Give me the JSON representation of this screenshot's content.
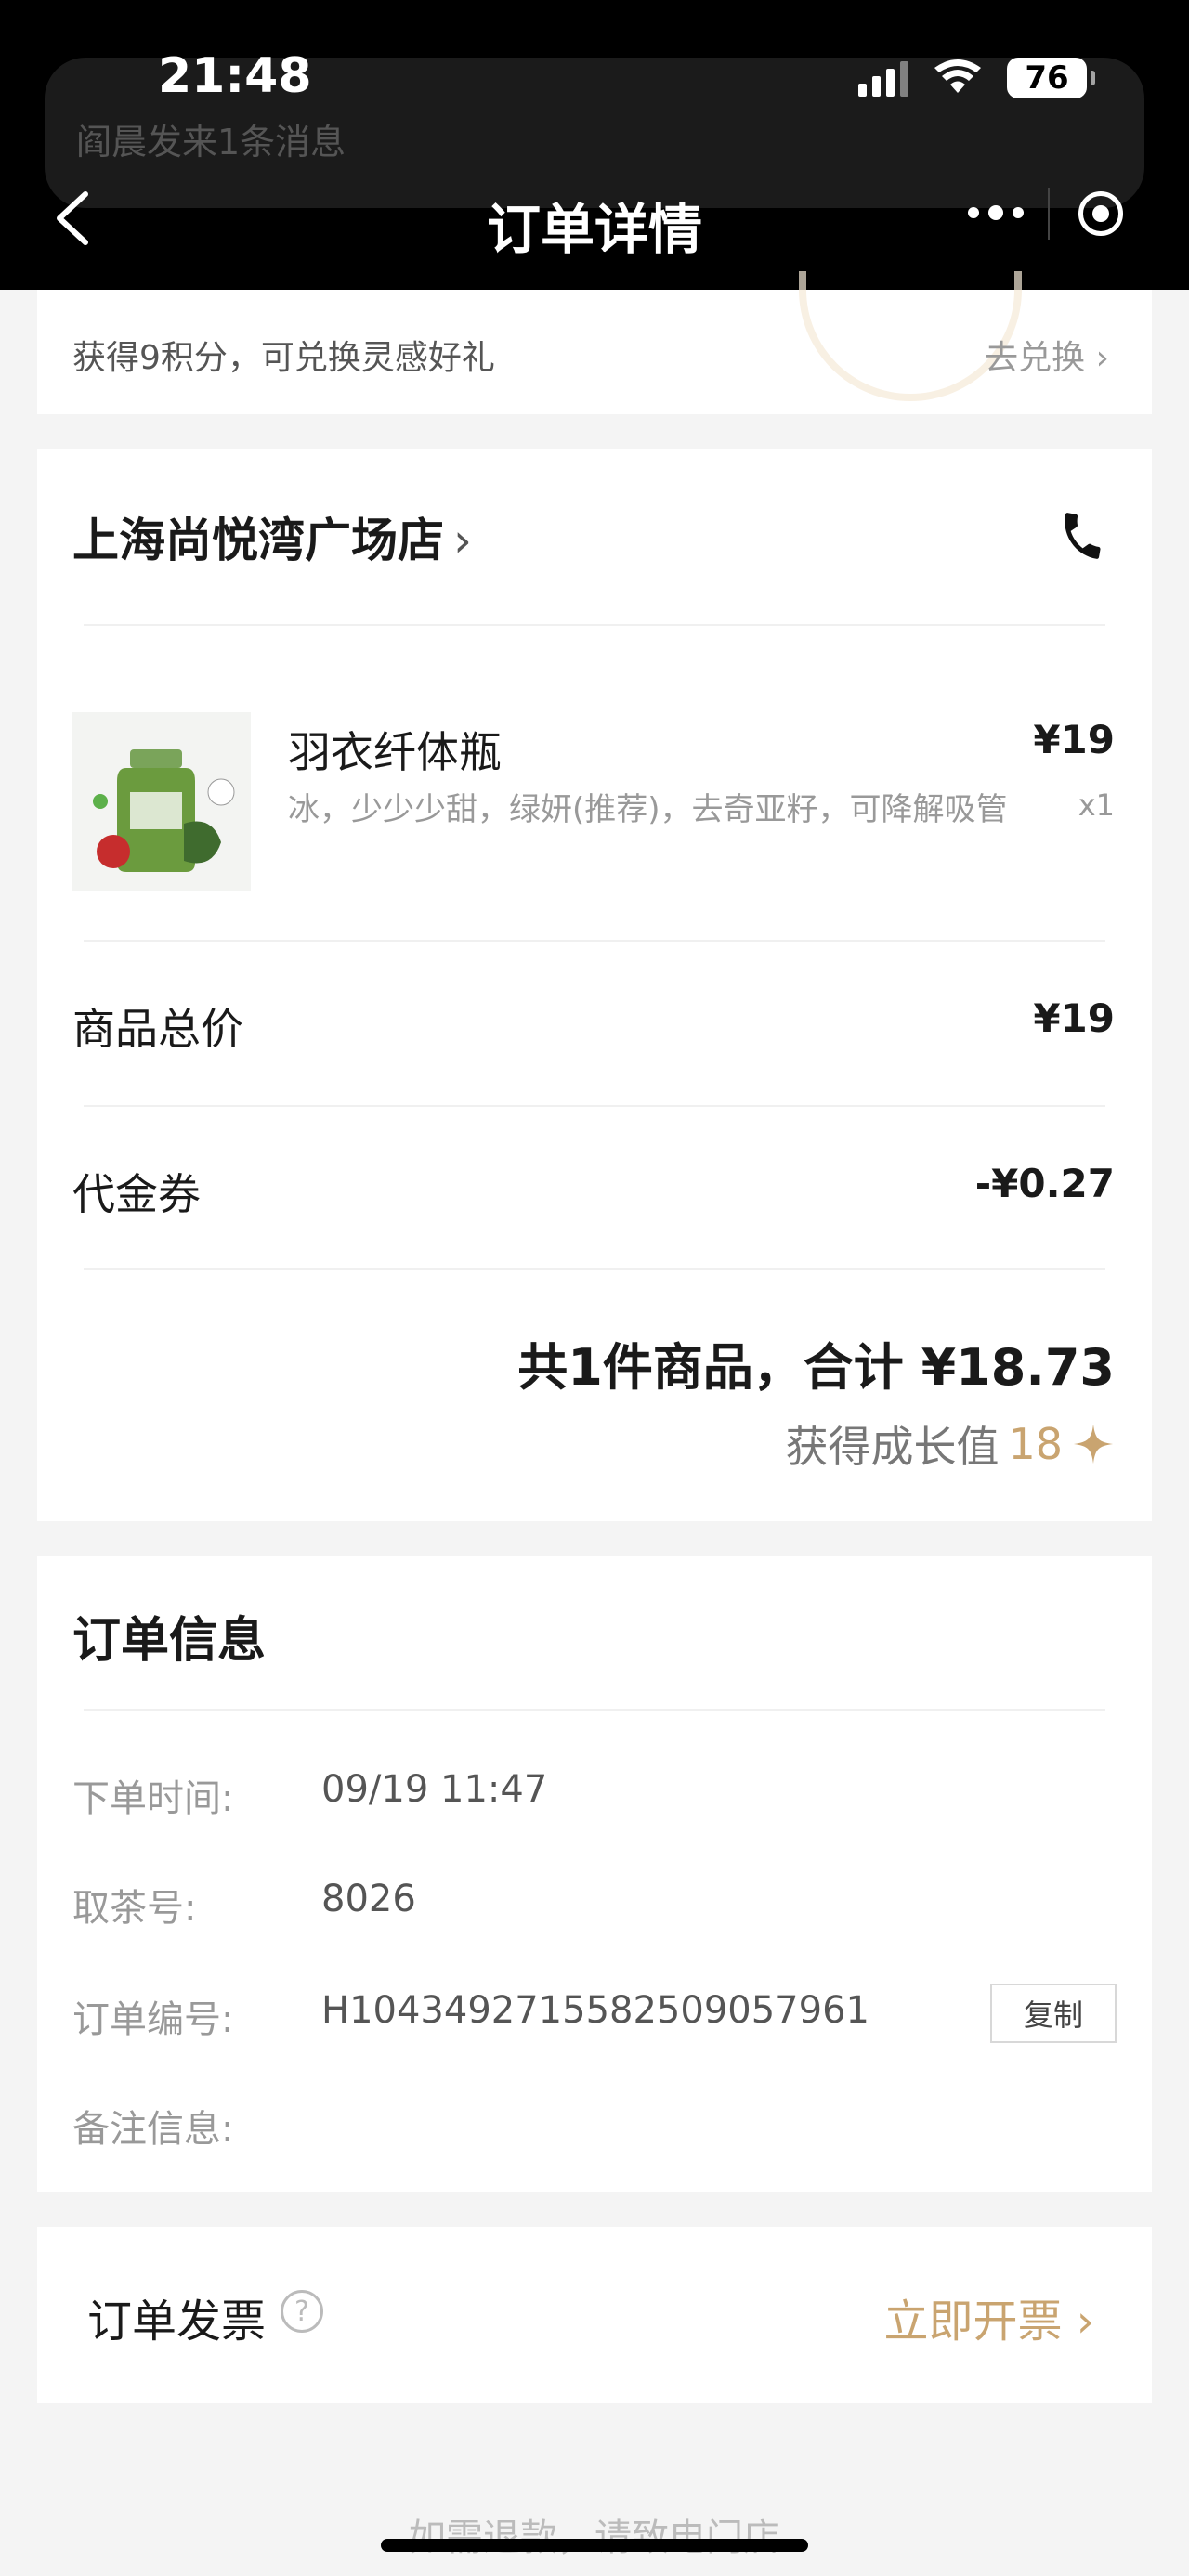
{
  "status_bar": {
    "time": "21:48",
    "battery": "76"
  },
  "notification": {
    "text": "阎晨发来1条消息"
  },
  "nav": {
    "title": "订单详情"
  },
  "points_banner": {
    "text": "获得9积分，可兑换灵感好礼",
    "action": "去兑换 ›"
  },
  "order": {
    "store_name": "上海尚悦湾广场店",
    "store_chevron": "›",
    "product": {
      "name": "羽衣纤体瓶",
      "spec": "冰，少少少甜，绿妍(推荐)，去奇亚籽，可降解吸管",
      "price": "¥19",
      "qty": "x1"
    },
    "subtotal_label": "商品总价",
    "subtotal_value": "¥19",
    "coupon_label": "代金券",
    "coupon_value": "-¥0.27",
    "summary": "共1件商品，合计 ¥18.73",
    "growth_label": "获得成长值",
    "growth_value": "18"
  },
  "order_info": {
    "title": "订单信息",
    "rows": [
      {
        "label": "下单时间:",
        "value": "09/19 11:47"
      },
      {
        "label": "取茶号:",
        "value": "8026"
      },
      {
        "label": "订单编号:",
        "value": "H1043492715582509057961"
      },
      {
        "label": "备注信息:",
        "value": ""
      }
    ],
    "copy_label": "复制"
  },
  "invoice": {
    "label": "订单发票",
    "help": "?",
    "action": "立即开票 ›"
  },
  "footer": {
    "note": "如需退款，请致电门店"
  },
  "colors": {
    "accent_gold": "#c9a470",
    "nav_bg": "#000000",
    "page_bg": "#f4f4f4"
  }
}
